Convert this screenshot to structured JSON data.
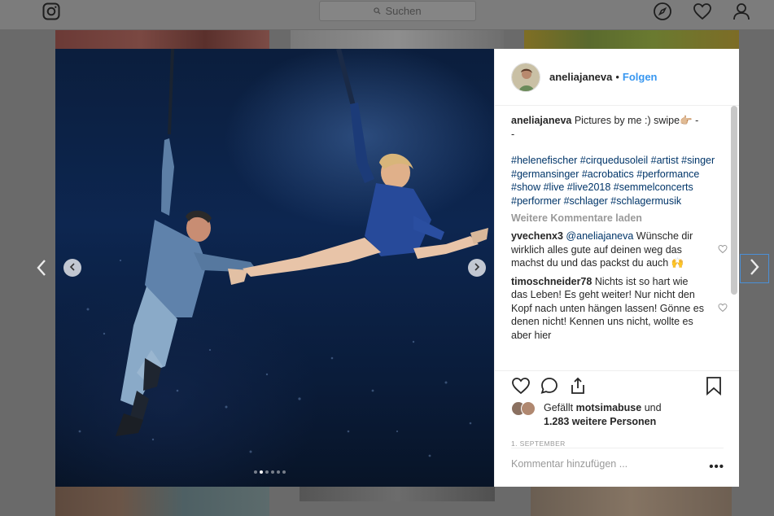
{
  "topbar": {
    "search_placeholder": "Suchen",
    "icons": [
      "instagram-icon",
      "compass-icon",
      "heart-icon",
      "profile-icon"
    ]
  },
  "post": {
    "username": "aneliajaneva",
    "separator": "•",
    "follow_label": "Folgen",
    "caption_user": "aneliajaneva",
    "caption_text": "Pictures by me :) swipe👉🏼 -",
    "caption_text_2": "-",
    "hashtags": "#helenefischer #cirquedusoleil #artist #singer #germansinger #acrobatics #performance #show #live #live2018 #semmelconcerts #performer #schlager #schlagermusik",
    "load_more_comments": "Weitere Kommentare laden",
    "comments": [
      {
        "user": "yvechenx3",
        "mention": "@aneliajaneva",
        "text": "Wünsche dir wirklich alles gute auf deinen weg das machst du und das packst du auch 🙌"
      },
      {
        "user": "timoschneider78",
        "text": "Nichts ist so hart wie das Leben! Es geht weiter! Nur nicht den Kopf nach unten hängen lassen! Gönne es denen nicht! Kennen uns nicht, wollte es aber hier"
      }
    ],
    "likes_prefix": "Gefällt",
    "likes_user": "motsimabuse",
    "likes_and": "und",
    "likes_others": "1.283 weitere Personen",
    "date": "1. SEPTEMBER",
    "add_comment_placeholder": "Kommentar hinzufügen ...",
    "more_options": "•••",
    "carousel": {
      "total_slides": 6,
      "active_slide": 2
    }
  },
  "colors": {
    "link_blue": "#3897f0",
    "hashtag_blue": "#003569",
    "text": "#262626",
    "muted": "#999999"
  }
}
